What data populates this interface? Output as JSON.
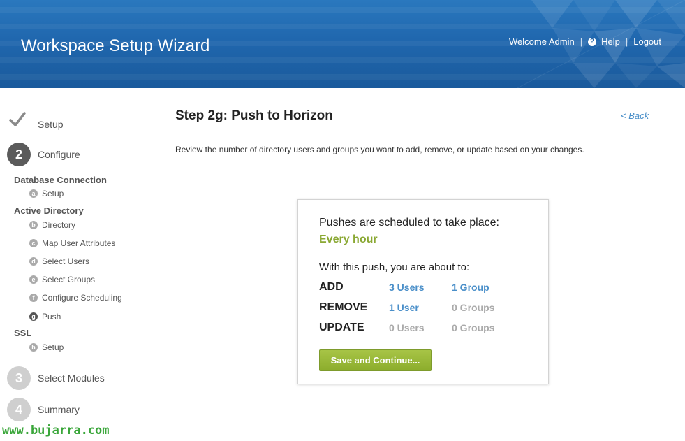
{
  "header": {
    "title": "Workspace Setup Wizard",
    "welcome": "Welcome Admin",
    "help": "Help",
    "logout": "Logout",
    "separator": "|"
  },
  "sidebar": {
    "step1": {
      "label": "Setup",
      "status": "completed"
    },
    "step2": {
      "number": "2",
      "label": "Configure"
    },
    "sections": [
      {
        "title": "Database Connection",
        "items": [
          {
            "letter": "a",
            "label": "Setup"
          }
        ]
      },
      {
        "title": "Active Directory",
        "items": [
          {
            "letter": "b",
            "label": "Directory"
          },
          {
            "letter": "c",
            "label": "Map User Attributes"
          },
          {
            "letter": "d",
            "label": "Select Users"
          },
          {
            "letter": "e",
            "label": "Select Groups"
          },
          {
            "letter": "f",
            "label": "Configure Scheduling"
          },
          {
            "letter": "g",
            "label": "Push",
            "current": true
          }
        ]
      },
      {
        "title": "SSL",
        "items": [
          {
            "letter": "h",
            "label": "Setup"
          }
        ]
      }
    ],
    "step3": {
      "number": "3",
      "label": "Select Modules"
    },
    "step4": {
      "number": "4",
      "label": "Summary"
    }
  },
  "main": {
    "title": "Step 2g: Push to Horizon",
    "back": "< Back",
    "description": "Review the number of directory users and groups you want to add, remove, or update based on your changes."
  },
  "card": {
    "schedule_text": "Pushes are scheduled to take place:",
    "schedule_value": "Every hour",
    "about_text": "With this push, you are about to:",
    "rows": [
      {
        "action": "ADD",
        "users": "3 Users",
        "groups": "1 Group"
      },
      {
        "action": "REMOVE",
        "users": "1 User",
        "groups": "0 Groups"
      },
      {
        "action": "UPDATE",
        "users": "0 Users",
        "groups": "0 Groups"
      }
    ],
    "save_label": "Save and Continue..."
  },
  "watermark": "www.bujarra.com",
  "colors": {
    "header": "#2067ae",
    "accent_green": "#8aa833",
    "link_blue": "#4a8fc9",
    "watermark_green": "#3aa63a"
  }
}
